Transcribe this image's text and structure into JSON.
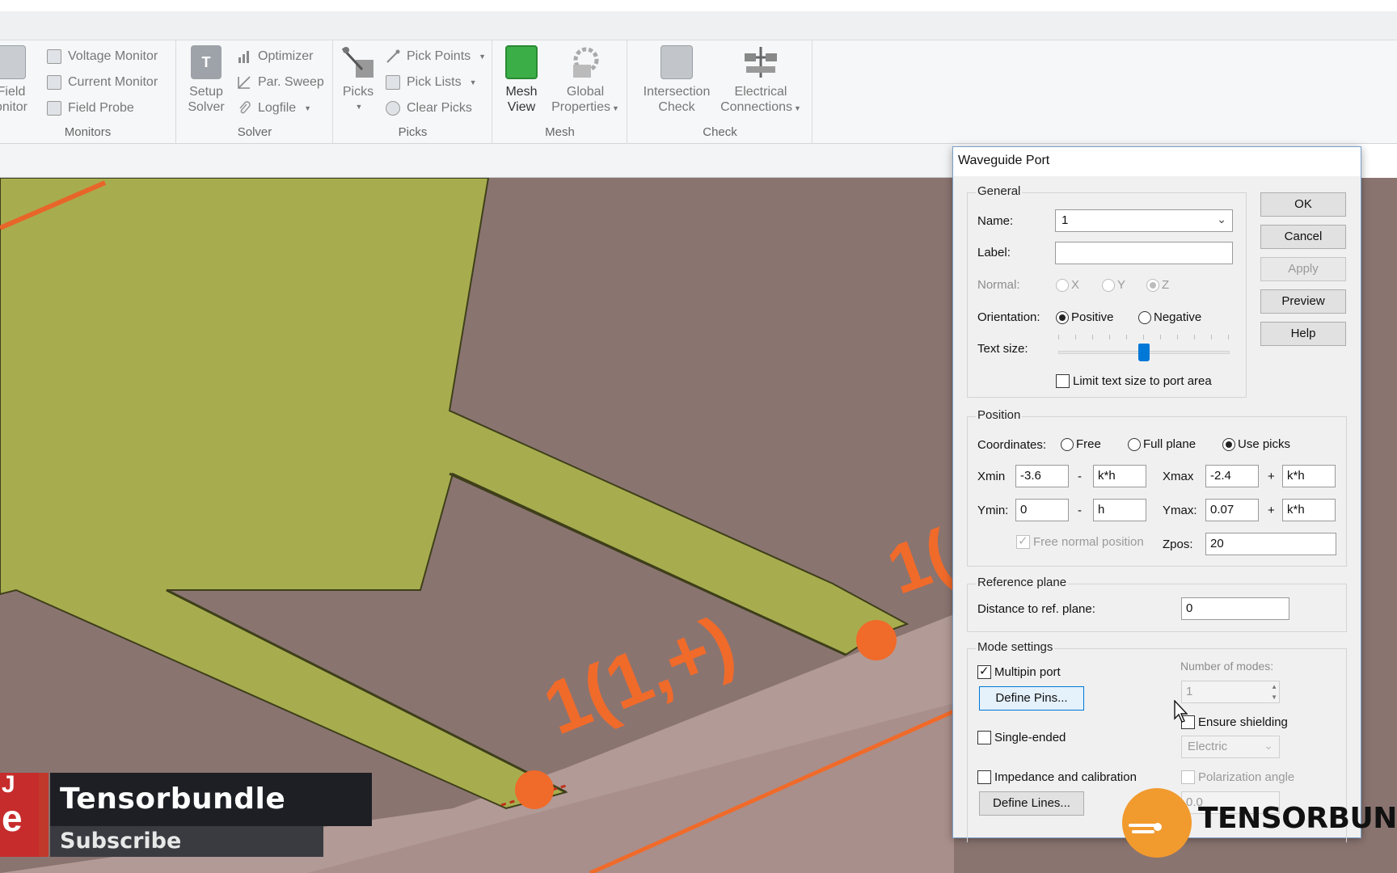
{
  "ribbon": {
    "monitors": {
      "field_monitor_line1": "Field",
      "field_monitor_line2": "onitor",
      "voltage_monitor": "Voltage Monitor",
      "current_monitor": "Current Monitor",
      "field_probe": "Field Probe",
      "group_label": "Monitors"
    },
    "solver": {
      "setup_line1": "Setup",
      "setup_line2": "Solver",
      "optimizer": "Optimizer",
      "par_sweep": "Par. Sweep",
      "logfile": "Logfile",
      "group_label": "Solver"
    },
    "picks": {
      "picks": "Picks",
      "pick_points": "Pick Points",
      "pick_lists": "Pick Lists",
      "clear_picks": "Clear Picks",
      "group_label": "Picks"
    },
    "mesh": {
      "mesh_view_line1": "Mesh",
      "mesh_view_line2": "View",
      "global_line1": "Global",
      "global_line2": "Properties",
      "group_label": "Mesh"
    },
    "check": {
      "intersection_line1": "Intersection",
      "intersection_line2": "Check",
      "electrical_line1": "Electrical",
      "electrical_line2": "Connections",
      "group_label": "Check"
    }
  },
  "viewport": {
    "port_label_main": "1(1,+)",
    "port_label_partial": "1("
  },
  "dialog": {
    "title": "Waveguide Port",
    "general": {
      "legend": "General",
      "name_label": "Name:",
      "name_value": "1",
      "label_label": "Label:",
      "label_value": "",
      "normal_label": "Normal:",
      "normal_options": [
        "X",
        "Y",
        "Z"
      ],
      "orientation_label": "Orientation:",
      "orientation_options": [
        "Positive",
        "Negative"
      ],
      "text_size_label": "Text size:",
      "text_size_level": 0.5,
      "limit_text": "Limit text size to port area"
    },
    "buttons": {
      "ok": "OK",
      "cancel": "Cancel",
      "apply": "Apply",
      "preview": "Preview",
      "help": "Help"
    },
    "position": {
      "legend": "Position",
      "coordinates_label": "Coordinates:",
      "coordinate_options": [
        "Free",
        "Full plane",
        "Use picks"
      ],
      "xmin_label": "Xmin",
      "xmin_value": "-3.6",
      "xmin_offset": "k*h",
      "xmax_label": "Xmax",
      "xmax_value": "-2.4",
      "xmax_offset": "k*h",
      "ymin_label": "Ymin:",
      "ymin_value": "0",
      "ymin_offset": "h",
      "ymax_label": "Ymax:",
      "ymax_value": "0.07",
      "ymax_offset": "k*h",
      "free_normal": "Free normal position",
      "zpos_label": "Zpos:",
      "zpos_value": "20",
      "minus": "-",
      "plus": "+"
    },
    "reference": {
      "legend": "Reference plane",
      "distance_label": "Distance to ref. plane:",
      "distance_value": "0"
    },
    "mode": {
      "legend": "Mode settings",
      "multipin": "Multipin port",
      "define_pins": "Define Pins...",
      "number_of_modes_label": "Number of modes:",
      "number_of_modes_value": "1",
      "ensure_shielding": "Ensure shielding",
      "single_ended": "Single-ended",
      "shielding_type": "Electric",
      "impedance": "Impedance and calibration",
      "polarization": "Polarization angle",
      "polarization_value": "0.0",
      "define_lines": "Define Lines..."
    }
  },
  "overlay": {
    "yt_text": "e",
    "yt_top": "J",
    "channel": "Tensorbundle",
    "subscribe": "Subscribe",
    "logo_text": "TENSORBUNDLE"
  },
  "colors": {
    "board": "#a7ad4e",
    "substrate": "#8a7470",
    "ground": "#b29a96",
    "port_orange": "#f06a2a",
    "accent": "#0078d7"
  }
}
